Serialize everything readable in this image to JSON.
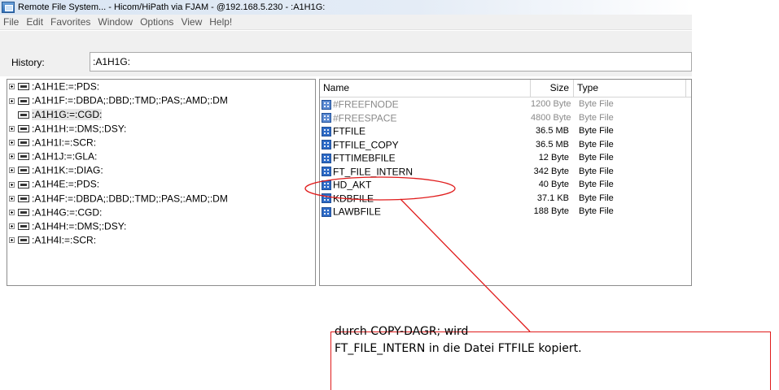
{
  "window": {
    "title": "Remote File System... - Hicom/HiPath via FJAM - @192.168.5.230 - :A1H1G:"
  },
  "menu": [
    "File",
    "Edit",
    "Favorites",
    "Window",
    "Options",
    "View",
    "Help!"
  ],
  "history": {
    "label": "History:",
    "value": ":A1H1G:"
  },
  "tree": [
    {
      "label": ":A1H1E:=:PDS:",
      "expandable": true,
      "selected": false
    },
    {
      "label": ":A1H1F:=:DBDA;:DBD;:TMD;:PAS;:AMD;:DM",
      "expandable": true,
      "selected": false
    },
    {
      "label": ":A1H1G:=:CGD:",
      "expandable": false,
      "selected": true
    },
    {
      "label": ":A1H1H:=:DMS;:DSY:",
      "expandable": true,
      "selected": false
    },
    {
      "label": ":A1H1I:=:SCR:",
      "expandable": true,
      "selected": false
    },
    {
      "label": ":A1H1J:=:GLA:",
      "expandable": true,
      "selected": false
    },
    {
      "label": ":A1H1K:=:DIAG:",
      "expandable": true,
      "selected": false
    },
    {
      "label": ":A1H4E:=:PDS:",
      "expandable": true,
      "selected": false
    },
    {
      "label": ":A1H4F:=:DBDA;:DBD;:TMD;:PAS;:AMD;:DM",
      "expandable": true,
      "selected": false
    },
    {
      "label": ":A1H4G:=:CGD:",
      "expandable": true,
      "selected": false
    },
    {
      "label": ":A1H4H:=:DMS;:DSY:",
      "expandable": true,
      "selected": false
    },
    {
      "label": ":A1H4I:=:SCR:",
      "expandable": true,
      "selected": false
    }
  ],
  "list": {
    "columns": {
      "name": "Name",
      "size": "Size",
      "type": "Type"
    },
    "rows": [
      {
        "name": "#FREEFNODE",
        "size": "1200 Byte",
        "type": "Byte File",
        "dim": true
      },
      {
        "name": "#FREESPACE",
        "size": "4800 Byte",
        "type": "Byte File",
        "dim": true
      },
      {
        "name": "FTFILE",
        "size": "36.5 MB",
        "type": "Byte File",
        "dim": false
      },
      {
        "name": "FTFILE_COPY",
        "size": "36.5 MB",
        "type": "Byte File",
        "dim": false
      },
      {
        "name": "FTTIMEBFILE",
        "size": "12 Byte",
        "type": "Byte File",
        "dim": false
      },
      {
        "name": "FT_FILE_INTERN",
        "size": "342 Byte",
        "type": "Byte File",
        "dim": false
      },
      {
        "name": "HD_AKT",
        "size": "40 Byte",
        "type": "Byte File",
        "dim": false
      },
      {
        "name": "KDBFILE",
        "size": "37.1 KB",
        "type": "Byte File",
        "dim": false
      },
      {
        "name": "LAWBFILE",
        "size": "188 Byte",
        "type": "Byte File",
        "dim": false
      }
    ]
  },
  "annotation": {
    "line1": "durch COPY-DAGR; wird",
    "line2": "FT_FILE_INTERN in die Datei FTFILE kopiert.",
    "color": "#e01b1b"
  }
}
